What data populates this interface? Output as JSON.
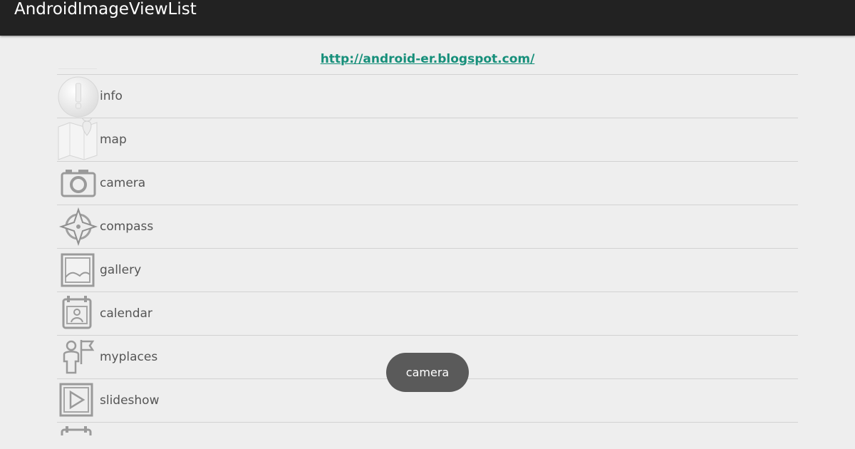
{
  "app": {
    "title": "AndroidImageViewList"
  },
  "header": {
    "link": "http://android-er.blogspot.com/"
  },
  "list": {
    "items": [
      {
        "label": "info",
        "icon": "info-icon"
      },
      {
        "label": "map",
        "icon": "map-icon"
      },
      {
        "label": "camera",
        "icon": "camera-icon"
      },
      {
        "label": "compass",
        "icon": "compass-icon"
      },
      {
        "label": "gallery",
        "icon": "gallery-icon"
      },
      {
        "label": "calendar",
        "icon": "calendar-icon"
      },
      {
        "label": "myplaces",
        "icon": "myplaces-icon"
      },
      {
        "label": "slideshow",
        "icon": "slideshow-icon"
      }
    ]
  },
  "toast": {
    "text": "camera"
  },
  "colors": {
    "action_bar": "#222222",
    "background": "#eeeeee",
    "link": "#168f7a",
    "toast": "#5a5a5a"
  }
}
